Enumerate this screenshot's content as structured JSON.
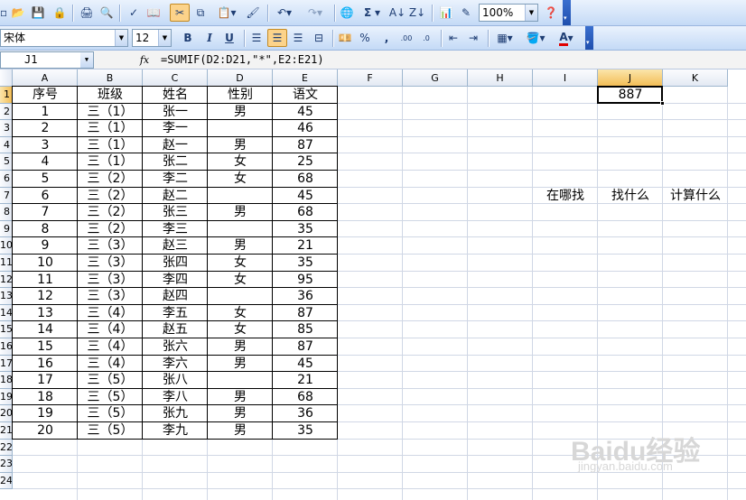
{
  "toolbar": {
    "zoom": "100%",
    "font_name": "宋体",
    "font_size": "12",
    "bold": "B",
    "italic": "I",
    "underline": "U",
    "percent": "%",
    "comma": ",",
    "sigma": "Σ",
    "font_color_glyph": "A",
    "accent_color": "#fcd38a"
  },
  "formula_bar": {
    "name_box": "J1",
    "fx": "fx",
    "formula": "=SUMIF(D2:D21,\"*\",E2:E21)"
  },
  "columns": [
    "A",
    "B",
    "C",
    "D",
    "E",
    "F",
    "G",
    "H",
    "I",
    "J",
    "K"
  ],
  "row_numbers": [
    "1",
    "2",
    "3",
    "4",
    "5",
    "6",
    "7",
    "8",
    "9",
    "10",
    "11",
    "12",
    "13",
    "14",
    "15",
    "16",
    "17",
    "18",
    "19",
    "20",
    "21",
    "22",
    "23",
    "24"
  ],
  "table": {
    "headers": [
      "序号",
      "班级",
      "姓名",
      "性别",
      "语文"
    ],
    "rows": [
      [
        "1",
        "三（1）",
        "张一",
        "男",
        "45"
      ],
      [
        "2",
        "三（1）",
        "李一",
        "",
        "46"
      ],
      [
        "3",
        "三（1）",
        "赵一",
        "男",
        "87"
      ],
      [
        "4",
        "三（1）",
        "张二",
        "女",
        "25"
      ],
      [
        "5",
        "三（2）",
        "李二",
        "女",
        "68"
      ],
      [
        "6",
        "三（2）",
        "赵二",
        "",
        "45"
      ],
      [
        "7",
        "三（2）",
        "张三",
        "男",
        "68"
      ],
      [
        "8",
        "三（2）",
        "李三",
        "",
        "35"
      ],
      [
        "9",
        "三（3）",
        "赵三",
        "男",
        "21"
      ],
      [
        "10",
        "三（3）",
        "张四",
        "女",
        "35"
      ],
      [
        "11",
        "三（3）",
        "李四",
        "女",
        "95"
      ],
      [
        "12",
        "三（3）",
        "赵四",
        "",
        "36"
      ],
      [
        "13",
        "三（4）",
        "李五",
        "女",
        "87"
      ],
      [
        "14",
        "三（4）",
        "赵五",
        "女",
        "85"
      ],
      [
        "15",
        "三（4）",
        "张六",
        "男",
        "87"
      ],
      [
        "16",
        "三（4）",
        "李六",
        "男",
        "45"
      ],
      [
        "17",
        "三（5）",
        "张八",
        "",
        "21"
      ],
      [
        "18",
        "三（5）",
        "李八",
        "男",
        "68"
      ],
      [
        "19",
        "三（5）",
        "张九",
        "男",
        "36"
      ],
      [
        "20",
        "三（5）",
        "李九",
        "男",
        "35"
      ]
    ]
  },
  "extra_cells": {
    "j1_value": "887",
    "i7": "在哪找",
    "j7": "找什么",
    "k7": "计算什么"
  },
  "watermark": {
    "brand": "Baidu经验",
    "url": "jingyan.baidu.com"
  }
}
